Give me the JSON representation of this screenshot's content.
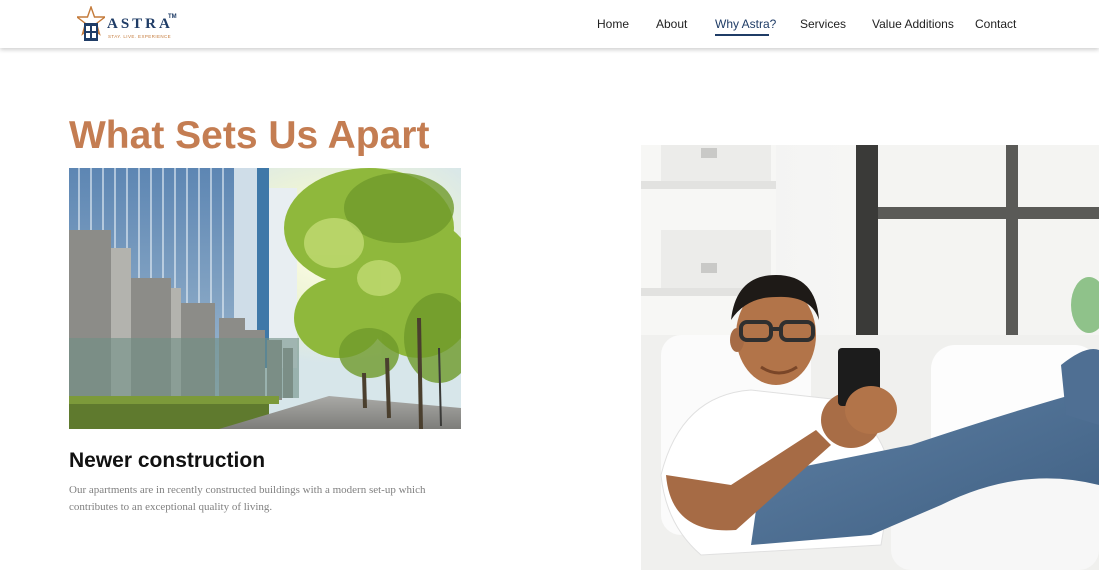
{
  "brand": {
    "name": "ASTRA",
    "trademark": "TM",
    "tagline": "STAY. LIVE. EXPERIENCE"
  },
  "nav": {
    "items": [
      {
        "label": "Home"
      },
      {
        "label": "About"
      },
      {
        "label": "Why Astra?",
        "active": true
      },
      {
        "label": "Services"
      },
      {
        "label": "Value Additions"
      },
      {
        "label": "Contact"
      }
    ]
  },
  "main": {
    "title": "What Sets Us Apart",
    "feature": {
      "title": "Newer construction",
      "description": "Our apartments are in recently constructed buildings with a modern set-up which contributes to an exceptional quality of living."
    }
  },
  "colors": {
    "accent": "#c47d52",
    "brand_navy": "#1f3c66",
    "nav_text": "#222222",
    "body_text": "#808080"
  }
}
